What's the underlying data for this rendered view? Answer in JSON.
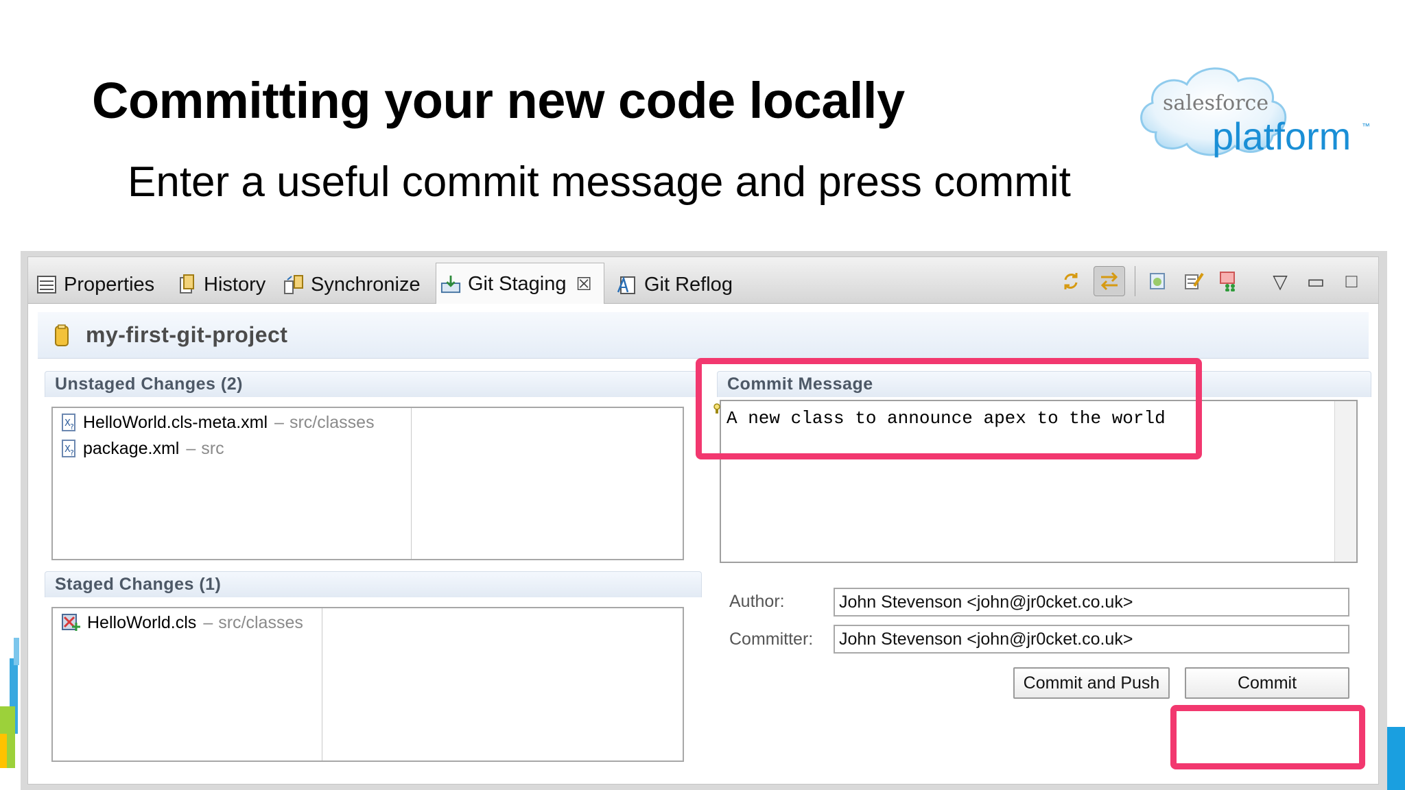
{
  "slide": {
    "title": "Committing your new code locally",
    "subtitle": "Enter a useful commit message and press commit"
  },
  "logo": {
    "brand": "salesforce",
    "product": "platform",
    "tm": "™"
  },
  "colors": {
    "highlight": "#f2386f",
    "logo_blue": "#1a8fd6",
    "section_text": "#4d5866"
  },
  "tabs": [
    {
      "label": "Properties",
      "icon": "properties-icon"
    },
    {
      "label": "History",
      "icon": "history-icon"
    },
    {
      "label": "Synchronize",
      "icon": "synchronize-icon"
    },
    {
      "label": "Git Staging",
      "icon": "git-staging-icon",
      "active": true,
      "close": "☒"
    },
    {
      "label": "Git Reflog",
      "icon": "git-reflog-icon"
    }
  ],
  "toolbar": {
    "icons": [
      "refresh-icon",
      "link-with-selection-icon",
      "compare-mode-icon",
      "commit-amend-icon",
      "sign-off-icon",
      "view-menu-icon",
      "minimize-icon",
      "maximize-icon"
    ],
    "view_menu_glyph": "▽",
    "minimize_glyph": "▭",
    "maximize_glyph": "□"
  },
  "project": {
    "name": "my-first-git-project"
  },
  "unstaged": {
    "header": "Unstaged Changes (2)",
    "files": [
      {
        "name": "HelloWorld.cls-meta.xml",
        "sep": "–",
        "path": "src/classes"
      },
      {
        "name": "package.xml",
        "sep": "–",
        "path": "src"
      }
    ]
  },
  "staged": {
    "header": "Staged Changes (1)",
    "files": [
      {
        "name": "HelloWorld.cls",
        "sep": "–",
        "path": "src/classes"
      }
    ]
  },
  "commit": {
    "header": "Commit Message",
    "message": "A new class to announce apex to the world",
    "author_label": "Author:",
    "author_value": "John Stevenson <john@jr0cket.co.uk>",
    "committer_label": "Committer:",
    "committer_value": "John Stevenson <john@jr0cket.co.uk>",
    "commit_and_push_label": "Commit and Push",
    "commit_label": "Commit"
  }
}
